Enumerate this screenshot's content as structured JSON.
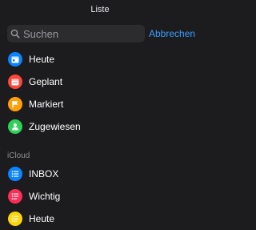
{
  "header": {
    "title": "Liste"
  },
  "search": {
    "placeholder": "Suchen",
    "cancel_label": "Abbrechen"
  },
  "smart_lists": [
    {
      "label": "Heute",
      "icon": "calendar-today-icon",
      "color": "#0a84ff"
    },
    {
      "label": "Geplant",
      "icon": "calendar-icon",
      "color": "#ff453a"
    },
    {
      "label": "Markiert",
      "icon": "flag-icon",
      "color": "#ff9f0a"
    },
    {
      "label": "Zugewiesen",
      "icon": "person-icon",
      "color": "#30d158"
    }
  ],
  "icloud": {
    "header": "iCloud",
    "lists": [
      {
        "label": "INBOX",
        "icon": "list-icon",
        "color": "#0a84ff"
      },
      {
        "label": "Wichtig",
        "icon": "list-shared-icon",
        "color": "#ff2d55"
      },
      {
        "label": "Heute",
        "icon": "list-shared-icon",
        "color": "#ffd60a"
      }
    ]
  }
}
